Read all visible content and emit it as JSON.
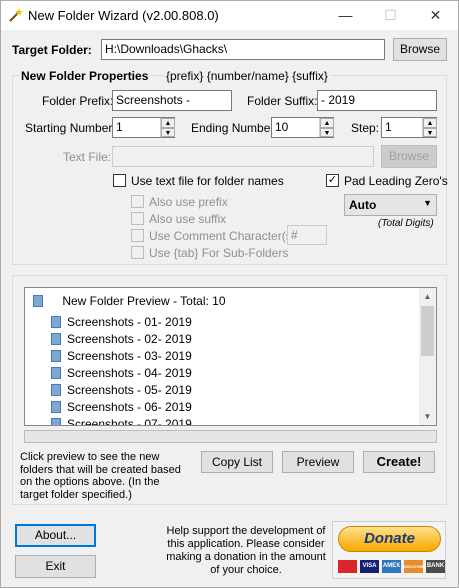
{
  "window": {
    "title": "New Folder Wizard",
    "version": "(v2.00.808.0)",
    "minimize_glyph": "—",
    "maximize_glyph": "☐",
    "close_glyph": "✕"
  },
  "target": {
    "label": "Target Folder:",
    "value": "H:\\Downloads\\Ghacks\\",
    "browse_label": "Browse"
  },
  "properties": {
    "heading": "New Folder Properties",
    "hint": "{prefix} {number/name} {suffix}",
    "prefix_label": "Folder Prefix:",
    "prefix_value": "Screenshots -",
    "suffix_label": "Folder Suffix:",
    "suffix_value": "- 2019",
    "start_label": "Starting Number:",
    "start_value": "1",
    "end_label": "Ending Number:",
    "end_value": "10",
    "step_label": "Step:",
    "step_value": "1",
    "textfile_label": "Text File:",
    "textfile_value": "",
    "textfile_browse": "Browse",
    "use_textfile_label": "Use text file for folder names",
    "use_textfile_checked": false,
    "pad_label": "Pad Leading Zero's",
    "pad_checked": true,
    "pad_mode": "Auto",
    "total_digits_label": "(Total Digits)",
    "also_prefix_label": "Also use prefix",
    "also_suffix_label": "Also use suffix",
    "comment_char_label": "Use Comment Character(s):",
    "comment_char_value": "#",
    "tab_label": "Use {tab} For Sub-Folders"
  },
  "preview": {
    "root_label": "New Folder Preview - Total: 10",
    "items": [
      "Screenshots - 01- 2019",
      "Screenshots - 02- 2019",
      "Screenshots - 03- 2019",
      "Screenshots - 04- 2019",
      "Screenshots - 05- 2019",
      "Screenshots - 06- 2019",
      "Screenshots - 07- 2019"
    ],
    "note": "Click preview to see the new folders that will be created based on the options above. (In the target folder specified.)",
    "copy_list_label": "Copy List",
    "preview_label": "Preview",
    "create_label": "Create!"
  },
  "footer": {
    "about_label": "About...",
    "exit_label": "Exit",
    "help_text": "Help support the development of this application. Please consider making a donation in the amount of your choice.",
    "donate_label": "Donate",
    "cards": [
      "VISA",
      "AMEX",
      "DISCOVER",
      "BANK"
    ]
  },
  "colors": {
    "accent": "#0078d7",
    "window_bg": "#f0f0f0",
    "donate_gold": "#f7a800"
  }
}
